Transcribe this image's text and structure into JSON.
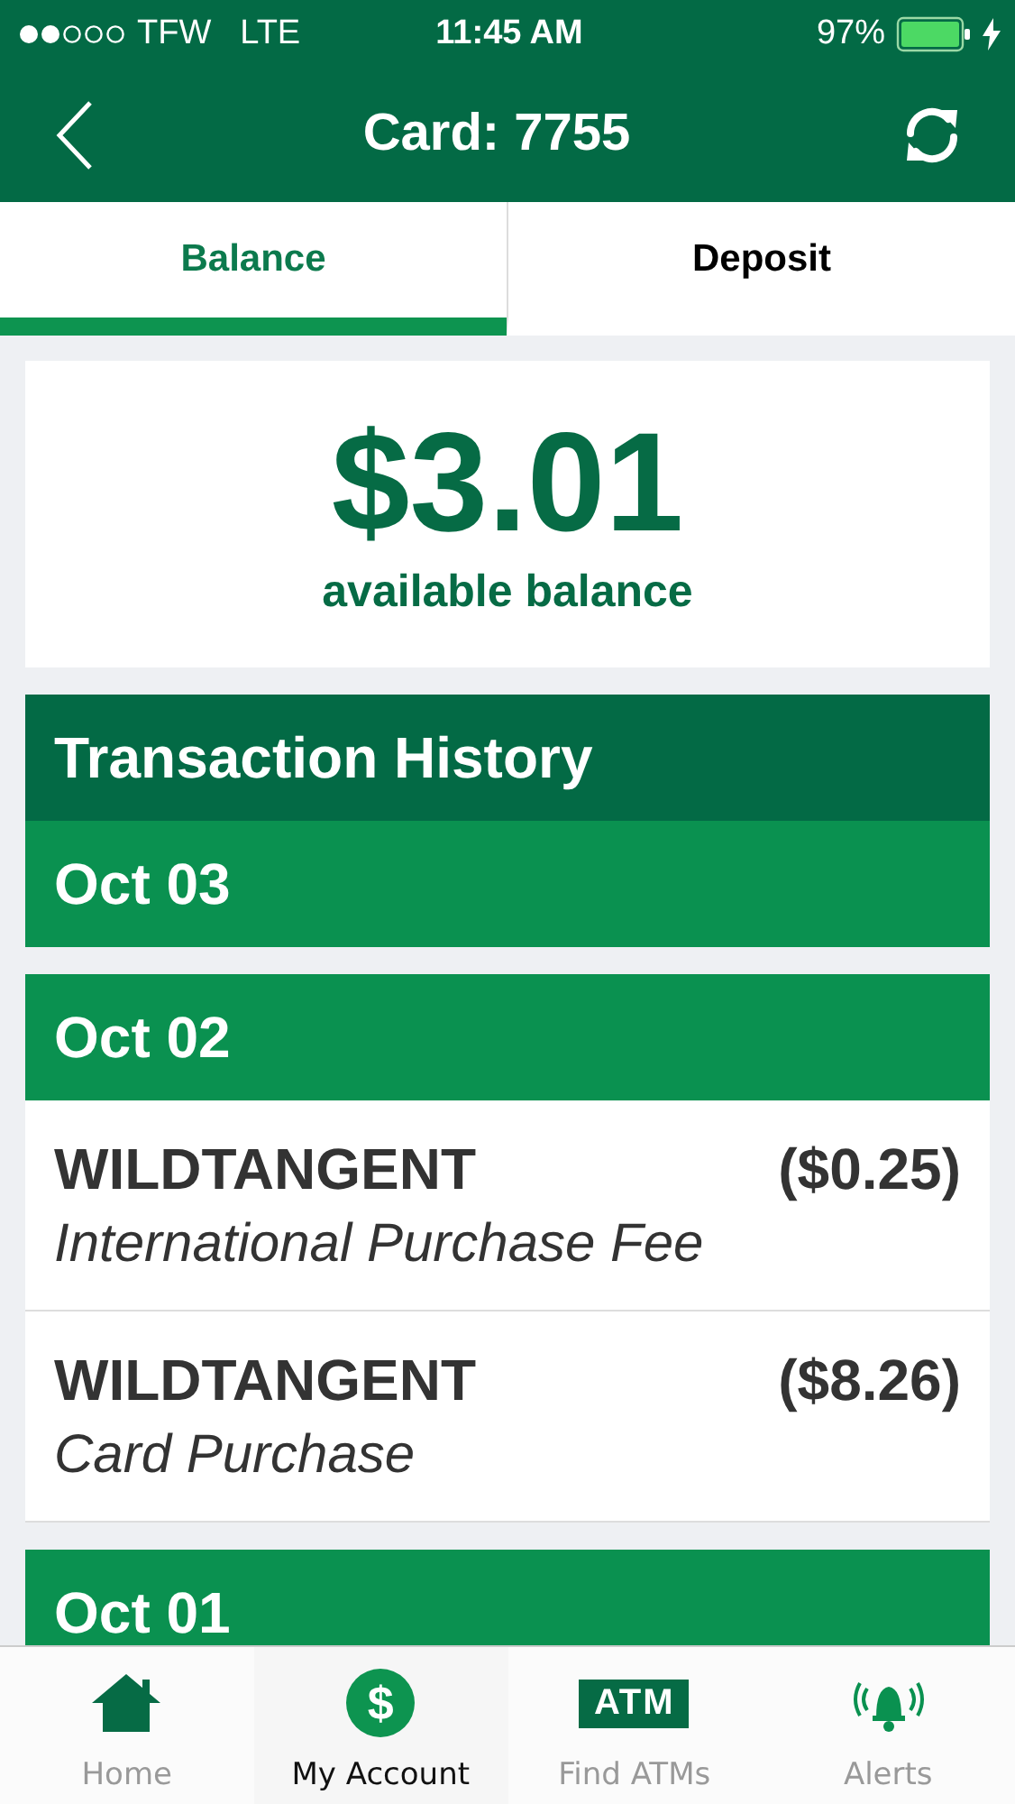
{
  "status_bar": {
    "carrier": "TFW",
    "network": "LTE",
    "time": "11:45 AM",
    "battery": "97%",
    "charging": true
  },
  "header": {
    "title": "Card: 7755"
  },
  "tabs": [
    {
      "label": "Balance",
      "selected": true
    },
    {
      "label": "Deposit",
      "selected": false
    }
  ],
  "balance": {
    "amount": "$3.01",
    "caption": "available balance"
  },
  "history": {
    "title": "Transaction History",
    "groups": [
      {
        "date": "Oct 03"
      },
      {
        "date": "Oct 02",
        "transactions": [
          {
            "merchant": "WILDTANGENT",
            "amount": "($0.25)",
            "description": "International Purchase Fee"
          },
          {
            "merchant": "WILDTANGENT",
            "amount": "($8.26)",
            "description": "Card Purchase"
          }
        ]
      },
      {
        "date": "Oct 01"
      }
    ]
  },
  "tab_bar": [
    {
      "kind": "home",
      "label": "Home",
      "selected": false
    },
    {
      "kind": "account",
      "label": "My Account",
      "selected": true,
      "icon_text": "$"
    },
    {
      "kind": "atm",
      "label": "Find ATMs",
      "selected": false,
      "icon_text": "ATM"
    },
    {
      "kind": "alerts",
      "label": "Alerts",
      "selected": false
    }
  ]
}
